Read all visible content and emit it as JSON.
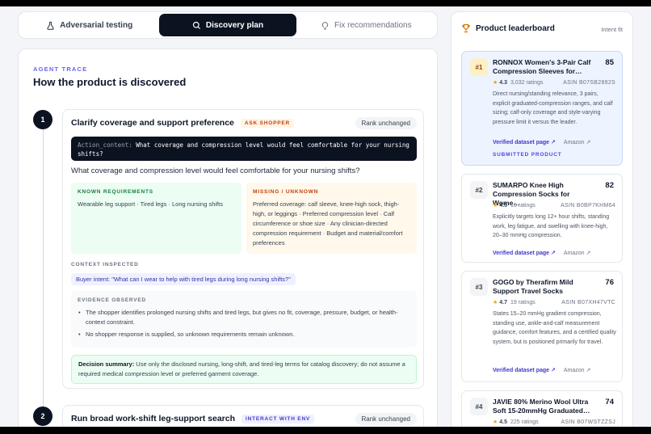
{
  "tabs": [
    {
      "label": "Adversarial testing",
      "icon": "flask-icon"
    },
    {
      "label": "Discovery plan",
      "icon": "search-icon"
    },
    {
      "label": "Fix recommendations",
      "icon": "lightbulb-icon"
    }
  ],
  "trace": {
    "eyebrow": "AGENT TRACE",
    "title": "How the product is discovered",
    "steps": [
      {
        "number": "1",
        "title": "Clarify coverage and support preference",
        "tag": "ASK SHOPPER",
        "rank": "Rank unchanged",
        "action_label": "Action_content:",
        "action_text": "What coverage and compression level would feel comfortable for your nursing shifts?",
        "question": "What coverage and compression level would feel comfortable for your nursing shifts?",
        "known_label": "KNOWN REQUIREMENTS",
        "known_text": "Wearable leg support · Tired legs · Long nursing shifts",
        "missing_label": "MISSING / UNKNOWN",
        "missing_text": "Preferred coverage: calf sleeve, knee-high sock, thigh-high, or leggings · Preferred compression level · Calf circumference or shoe size · Any clinician-directed compression requirement · Budget and material/comfort preferences",
        "context_label": "CONTEXT INSPECTED",
        "intent": "Buyer intent: \"What can I wear to help with tired legs during long nursing shifts?\"",
        "evidence_label": "EVIDENCE OBSERVED",
        "evidence": [
          "The shopper identifies prolonged nursing shifts and tired legs, but gives no fit, coverage, pressure, budget, or health-context constraint.",
          "No shopper response is supplied, so unknown requirements remain unknown."
        ],
        "decision_label": "Decision summary:",
        "decision_text": "Use only the disclosed nursing, long-shift, and tired-leg terms for catalog discovery; do not assume a required medical compression level or preferred garment coverage."
      },
      {
        "number": "2",
        "title": "Run broad work-shift leg-support search",
        "tag": "INTERACT WITH ENV",
        "rank": "Rank unchanged"
      }
    ]
  },
  "leaderboard": {
    "title": "Product leaderboard",
    "subtitle": "Intent fit",
    "verified_label": "Verified dataset page",
    "amazon_label": "Amazon",
    "submitted_label": "SUBMITTED PRODUCT",
    "products": [
      {
        "rank": "#1",
        "name": "RONNOX Women's 3-Pair Calf Compression Sleeves for…",
        "score": "85",
        "rating": "4.3",
        "ratings": "3,032 ratings",
        "asin": "ASIN B07SB2892S",
        "desc": "Direct nursing/standing relevance, 3 pairs, explicit graduated-compression ranges, and calf sizing; calf-only coverage and style-varying pressure limit it versus the leader."
      },
      {
        "rank": "#2",
        "name": "SUMARPO Knee High Compression Socks for Wome…",
        "score": "82",
        "rating": "4.5",
        "ratings": "15 ratings",
        "asin": "ASIN B0BP7KHM64",
        "desc": "Explicitly targets long 12+ hour shifts, standing work, leg fatigue, and swelling with knee-high, 20–30 mmHg compression."
      },
      {
        "rank": "#3",
        "name": "GOGO by Therafirm Mild Support Travel Socks",
        "score": "76",
        "rating": "4.7",
        "ratings": "19 ratings",
        "asin": "ASIN B07XH47VTC",
        "desc": "States 15–20 mmHg gradient compression, standing use, ankle-and-calf measurement guidance, comfort features, and a certified quality system, but is positioned primarily for travel."
      },
      {
        "rank": "#4",
        "name": "JAVIE 80% Merino Wool Ultra Soft 15-20mmHg Graduated…",
        "score": "74",
        "rating": "4.5",
        "ratings": "225 ratings",
        "asin": "ASIN B07WSTZZSJ",
        "desc": ""
      }
    ]
  },
  "colors": {
    "accent": "#6366f1",
    "dark": "#0b1220",
    "star": "#f59e0b"
  }
}
